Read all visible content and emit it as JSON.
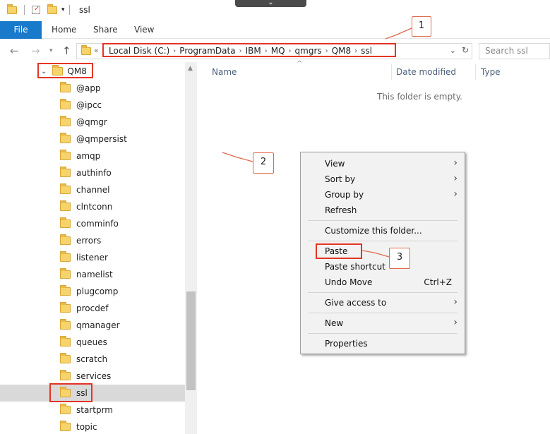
{
  "window": {
    "title": "ssl",
    "collapse_icon": "chevron-down-icon"
  },
  "ribbon": {
    "tabs": [
      "File",
      "Home",
      "Share",
      "View"
    ]
  },
  "nav": {
    "back_icon": "arrow-left-icon",
    "forward_icon": "arrow-right-icon",
    "recent_icon": "chevron-down-icon",
    "up_icon": "arrow-up-icon",
    "overflow": "«",
    "breadcrumbs": [
      "Local Disk (C:)",
      "ProgramData",
      "IBM",
      "MQ",
      "qmgrs",
      "QM8",
      "ssl"
    ],
    "search_placeholder": "Search ssl"
  },
  "tree": {
    "root": "QM8",
    "items": [
      "@app",
      "@ipcc",
      "@qmgr",
      "@qmpersist",
      "amqp",
      "authinfo",
      "channel",
      "clntconn",
      "comminfo",
      "errors",
      "listener",
      "namelist",
      "plugcomp",
      "procdef",
      "qmanager",
      "queues",
      "scratch",
      "services",
      "ssl",
      "startprm",
      "topic"
    ],
    "selected": "ssl"
  },
  "columns": {
    "name": "Name",
    "date": "Date modified",
    "type": "Type"
  },
  "empty_message": "This folder is empty.",
  "context_menu": {
    "view": "View",
    "sort_by": "Sort by",
    "group_by": "Group by",
    "refresh": "Refresh",
    "customize": "Customize this folder...",
    "paste": "Paste",
    "paste_shortcut": "Paste shortcut",
    "undo_move": "Undo Move",
    "undo_shortcut": "Ctrl+Z",
    "give_access": "Give access to",
    "new": "New",
    "properties": "Properties"
  },
  "callouts": [
    "1",
    "2",
    "3"
  ],
  "colors": {
    "accent": "#1979ca",
    "highlight": "#e53424",
    "folder": "#f7d36b"
  }
}
